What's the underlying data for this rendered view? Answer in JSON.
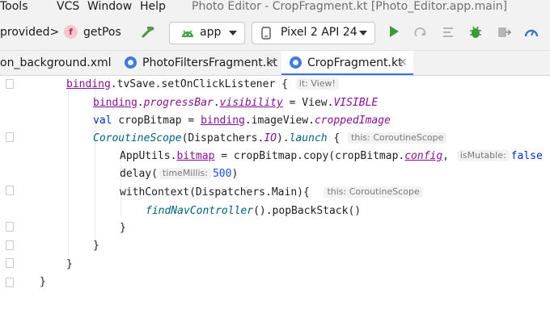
{
  "menu": {
    "tools": "Tools",
    "vcs": "VCS",
    "window": "Window",
    "help": "Help"
  },
  "window_title": "Photo Editor - CropFragment.kt [Photo_Editor.app.main]",
  "toolbar": {
    "crumb_left": "provided>",
    "func_badge": "f",
    "func_name": "getPos",
    "run_config": "app",
    "device": "Pixel 2 API 24"
  },
  "tabs": [
    {
      "label": "on_background.xml"
    },
    {
      "label": "PhotoFiltersFragment.kt",
      "close": "×"
    },
    {
      "label": "CropFragment.kt",
      "close": "×",
      "active": true
    }
  ],
  "code": {
    "l1_obj": "binding",
    "l1_rest": ".tvSave.setOnClickListener {",
    "l1_hint": "it: View!",
    "l2_obj": "binding",
    "l2_dot": ".",
    "l2_prop": "progressBar",
    "l2_dot2": ".",
    "l2_vis": "visibility",
    "l2_eq": " = View.",
    "l2_const": "VISIBLE",
    "l3_kw": "val",
    "l3_mid": " cropBitmap = ",
    "l3_obj": "binding",
    "l3_rest": ".imageView.",
    "l3_prop": "croppedImage",
    "l4_fn": "CoroutineScope",
    "l4_mid": "(Dispatchers.",
    "l4_io": "IO",
    "l4_close": ").",
    "l4_launch": "launch",
    "l4_brace": " {",
    "l4_hint": "this: CoroutineScope",
    "l5_start": "AppUtils.",
    "l5_bitmap": "bitmap",
    "l5_mid": " = cropBitmap.copy(cropBitmap.",
    "l5_config": "config",
    "l5_comma": ",",
    "l5_hint": "isMutable:",
    "l5_false": "false",
    "l6_start": "delay(",
    "l6_hint": "timeMillis:",
    "l6_num": "500",
    "l6_end": ")",
    "l7_text": "withContext(Dispatchers.Main){",
    "l7_hint": "this: CoroutineScope",
    "l8_fn": "findNavController",
    "l8_rest": "().popBackStack()",
    "l9": "}",
    "l10": "}",
    "l11": "}",
    "l12": "}"
  },
  "colors": {
    "accent": "#3574f0",
    "run": "#3b9a3b",
    "bug": "#3b9a3b",
    "keyword": "#0033b3",
    "property": "#871094"
  }
}
